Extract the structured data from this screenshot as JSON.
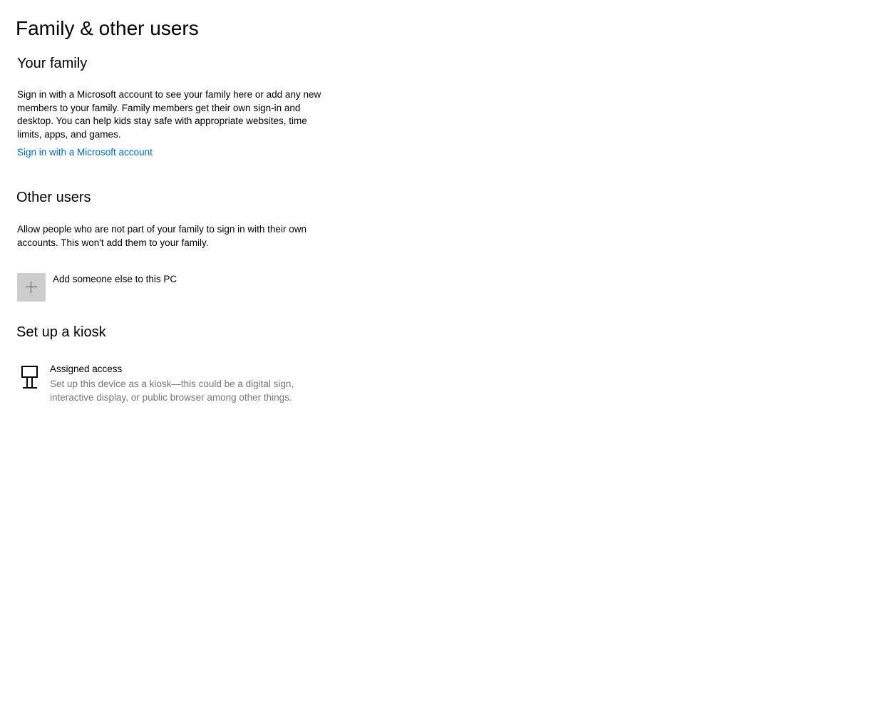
{
  "title": "Family & other users",
  "family": {
    "heading": "Your family",
    "text_lines": [
      "Sign in with a Microsoft account to see your family here or add any new",
      "members to your family. Family members get their own sign-in and",
      "desktop. You can help kids stay safe with appropriate websites, time",
      "limits, apps, and games."
    ],
    "link": "Sign in with a Microsoft account"
  },
  "other": {
    "heading": "Other users",
    "text_lines": [
      "Allow people who are not part of your family to sign in with their own",
      "accounts. This won't add them to your family."
    ],
    "add_label": "Add someone else to this PC"
  },
  "kiosk": {
    "heading": "Set up a kiosk",
    "item_title": "Assigned access",
    "item_desc_lines": [
      "Set up this device as a kiosk—this could be a digital sign,",
      "interactive display, or public browser among other things."
    ]
  }
}
